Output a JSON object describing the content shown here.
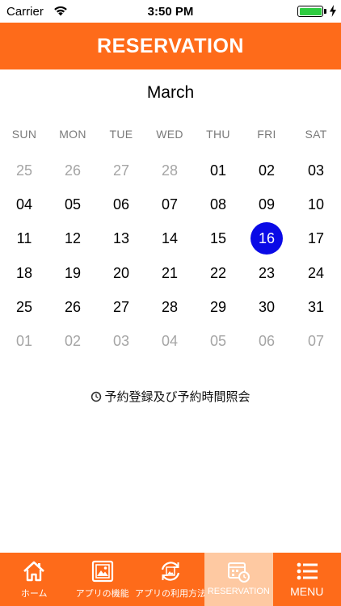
{
  "status": {
    "carrier": "Carrier",
    "time": "3:50 PM"
  },
  "header": {
    "title": "RESERVATION"
  },
  "calendar": {
    "month": "March",
    "weekdays": [
      "SUN",
      "MON",
      "TUE",
      "WED",
      "THU",
      "FRI",
      "SAT"
    ],
    "weeks": [
      [
        {
          "d": "25",
          "m": true
        },
        {
          "d": "26",
          "m": true
        },
        {
          "d": "27",
          "m": true
        },
        {
          "d": "28",
          "m": true
        },
        {
          "d": "01"
        },
        {
          "d": "02"
        },
        {
          "d": "03"
        }
      ],
      [
        {
          "d": "04"
        },
        {
          "d": "05"
        },
        {
          "d": "06"
        },
        {
          "d": "07"
        },
        {
          "d": "08"
        },
        {
          "d": "09"
        },
        {
          "d": "10"
        }
      ],
      [
        {
          "d": "11"
        },
        {
          "d": "12"
        },
        {
          "d": "13"
        },
        {
          "d": "14"
        },
        {
          "d": "15"
        },
        {
          "d": "16",
          "selected": true
        },
        {
          "d": "17"
        }
      ],
      [
        {
          "d": "18"
        },
        {
          "d": "19"
        },
        {
          "d": "20"
        },
        {
          "d": "21"
        },
        {
          "d": "22"
        },
        {
          "d": "23"
        },
        {
          "d": "24"
        }
      ],
      [
        {
          "d": "25"
        },
        {
          "d": "26"
        },
        {
          "d": "27"
        },
        {
          "d": "28"
        },
        {
          "d": "29"
        },
        {
          "d": "30"
        },
        {
          "d": "31"
        }
      ],
      [
        {
          "d": "01",
          "m": true
        },
        {
          "d": "02",
          "m": true
        },
        {
          "d": "03",
          "m": true
        },
        {
          "d": "04",
          "m": true
        },
        {
          "d": "05",
          "m": true
        },
        {
          "d": "06",
          "m": true
        },
        {
          "d": "07",
          "m": true
        }
      ]
    ],
    "selected_color": "#0a0ae6",
    "muted_color": "#a5a5a5"
  },
  "inquiry": {
    "label": "予約登録及び予約時間照会",
    "icon": "clock-icon"
  },
  "tabbar": {
    "accent": "#fe6b1a",
    "active_bg": "#fec9a2",
    "items": [
      {
        "label": "ホーム",
        "icon": "home-icon"
      },
      {
        "label": "アプリの機能",
        "icon": "image-frame-icon"
      },
      {
        "label": "アプリの利用方法",
        "icon": "refresh-image-icon"
      },
      {
        "label": "RESERVATION",
        "icon": "calendar-clock-icon",
        "active": true
      },
      {
        "label": "MENU",
        "icon": "menu-list-icon"
      }
    ]
  }
}
